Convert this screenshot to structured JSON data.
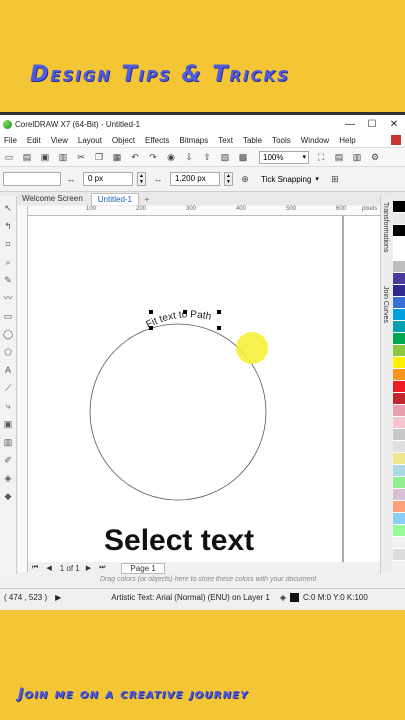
{
  "banner": {
    "top_title": "Design Tips & Tricks",
    "bottom_title": "Join me on a creative journey"
  },
  "window": {
    "title": "CorelDRAW X7 (64-Bit) - Untitled-1",
    "controls": [
      "—",
      "☐",
      "✕"
    ]
  },
  "menu": [
    "File",
    "Edit",
    "View",
    "Layout",
    "Object",
    "Effects",
    "Bitmaps",
    "Text",
    "Table",
    "Tools",
    "Window",
    "Help"
  ],
  "toolbar": {
    "zoom": "100%"
  },
  "propbar": {
    "x_value": "0 px",
    "width_value": "1,200 px",
    "snap_label": "Tick Snapping"
  },
  "tabs": [
    "Welcome Screen",
    "Untitled-1"
  ],
  "ruler": {
    "ticks": [
      "100",
      "200",
      "300",
      "400",
      "500",
      "600"
    ],
    "unit": "pixels"
  },
  "canvas": {
    "path_text": "Fit text to Path"
  },
  "dockers": [
    "Transformations",
    "Join Curves"
  ],
  "pagebar": {
    "page_count": "1 of 1",
    "page_tab": "Page 1"
  },
  "colorbar_hint": "Drag colors (or objects) here to store these colors with your document",
  "status": {
    "coords": "( 474 , 523 )",
    "object_info": "Artistic Text: Arial (Normal) (ENU) on Layer 1",
    "fill_info": "C:0 M:0 Y:0 K:100"
  },
  "caption": "Select text",
  "colors": {
    "banner_bg": "#f4c534",
    "banner_text": "#4f5ce0",
    "highlight": "#f7ef3a",
    "palette": [
      "#000000",
      "#e8e8e8",
      "#000000",
      "#ffffff",
      "#ffffff",
      "#bdbdbd",
      "#4b3a9e",
      "#2a2a8f",
      "#3a6fd8",
      "#00a0e0",
      "#00a0b0",
      "#00a651",
      "#8dc63f",
      "#fff200",
      "#f7941d",
      "#ed1c24",
      "#c1272d",
      "#e8a0b0",
      "#f5c6d0",
      "#c8c8c8",
      "#e0e0e0",
      "#f0e68c",
      "#add8e6",
      "#90ee90",
      "#d8bfd8",
      "#ffa07a",
      "#87cefa",
      "#98fb98",
      "#f0f0f0",
      "#dcdcdc"
    ]
  }
}
